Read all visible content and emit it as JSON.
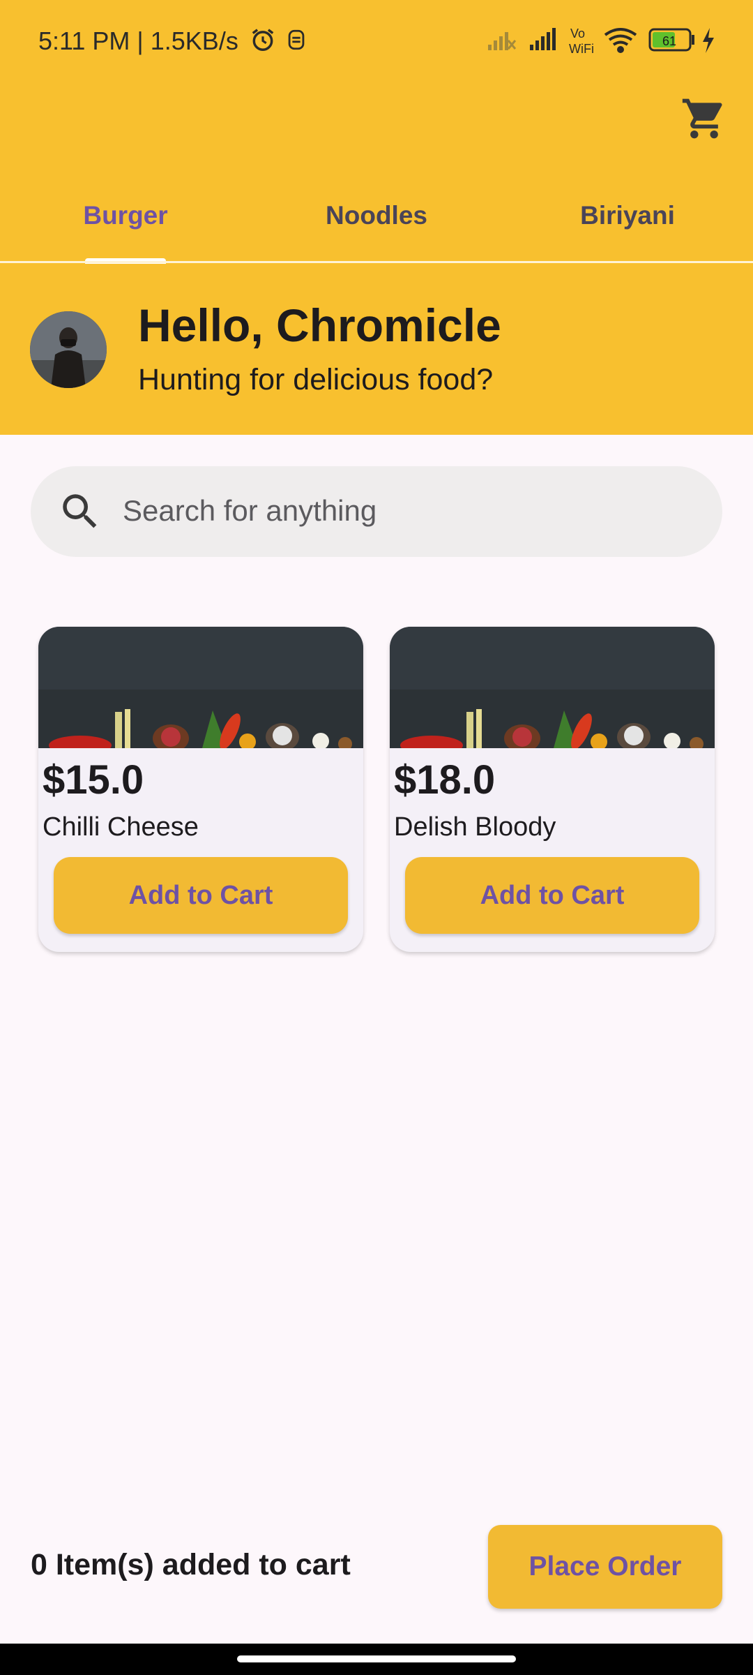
{
  "status_bar": {
    "time_speed": "5:11 PM | 1.5KB/s",
    "battery": "61",
    "network_label_top": "Vo",
    "network_label_bottom": "WiFi"
  },
  "tabs": [
    {
      "label": "Burger",
      "active": true
    },
    {
      "label": "Noodles",
      "active": false
    },
    {
      "label": "Biriyani",
      "active": false
    }
  ],
  "header": {
    "greeting": "Hello, Chromicle",
    "subtitle": "Hunting for delicious food?"
  },
  "search": {
    "placeholder": "Search for anything"
  },
  "products": [
    {
      "price": "$15.0",
      "name": "Chilli Cheese",
      "button": "Add to Cart"
    },
    {
      "price": "$18.0",
      "name": "Delish Bloody",
      "button": "Add to Cart"
    }
  ],
  "footer": {
    "cart_count": "0 Item(s) added to cart",
    "place_order": "Place Order"
  },
  "colors": {
    "primary": "#f8c02f",
    "button": "#f2ba33",
    "accent_text": "#6e52a4",
    "background": "#fdf7fb"
  },
  "icons": [
    "alarm-icon",
    "signal-icon",
    "wifi-icon",
    "battery-icon",
    "charging-icon",
    "cart-icon",
    "search-icon",
    "avatar"
  ]
}
